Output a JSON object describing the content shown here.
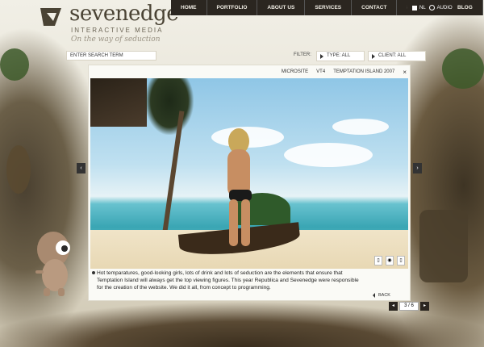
{
  "brand": {
    "name": "sevenedge",
    "subtitle": "INTERACTIVE MEDIA",
    "tagline": "On the way of seduction"
  },
  "nav": {
    "items": [
      "HOME",
      "PORTFOLIO",
      "ABOUT US",
      "SERVICES",
      "CONTACT",
      "SHOWREEL",
      "BLOG"
    ]
  },
  "lang": {
    "label": "NL",
    "audio_label": "AUDIO"
  },
  "search": {
    "placeholder": "ENTER SEARCH TERM"
  },
  "filter": {
    "label": "FILTER:",
    "type_value": "TYPE: ALL",
    "client_value": "CLIENT: ALL"
  },
  "breadcrumb": {
    "section": "MICROSITE",
    "client": "VT4",
    "title": "TEMPTATION ISLAND 2007",
    "close": "×"
  },
  "project": {
    "description": "Hot temparatures, good-looking girls, lots of drink and lots of seduction are the elements that ensure that Temptation Island will always get the top viewing figures. This year Republica and Sevenedge were responsible for the creation of the website. We did it all, from concept to programming.",
    "back_label": "BACK"
  },
  "pager": {
    "count": "3 / 6"
  },
  "colors": {
    "accent": "#2b2620",
    "panel": "#fafaf6",
    "text": "#222222"
  }
}
